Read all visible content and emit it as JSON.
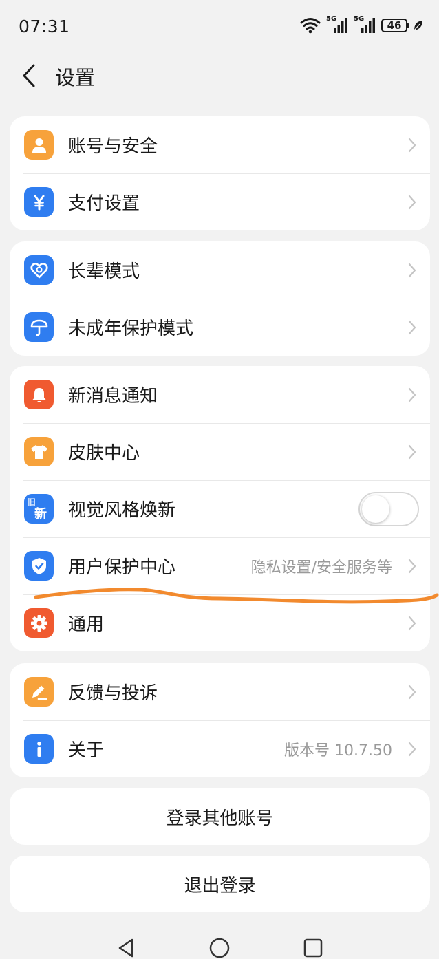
{
  "status": {
    "time": "07:31",
    "net1": "5G",
    "net2": "5G",
    "battery": "46"
  },
  "header": {
    "title": "设置"
  },
  "groups": [
    {
      "items": [
        {
          "label": "账号与安全",
          "icon": "user-icon",
          "color": "#f7a23b"
        },
        {
          "label": "支付设置",
          "icon": "yuan-icon",
          "color": "#2f7df0"
        }
      ]
    },
    {
      "items": [
        {
          "label": "长辈模式",
          "icon": "heart-icon",
          "color": "#2f7df0"
        },
        {
          "label": "未成年保护模式",
          "icon": "umbrella-icon",
          "color": "#2f7df0"
        }
      ]
    },
    {
      "items": [
        {
          "label": "新消息通知",
          "icon": "bell-icon",
          "color": "#f05a30"
        },
        {
          "label": "皮肤中心",
          "icon": "shirt-icon",
          "color": "#f7a23b"
        },
        {
          "label": "视觉风格焕新",
          "icon": "new-style-icon",
          "color": "#2f7df0",
          "icon_text_old": "旧",
          "icon_text_new": "新",
          "toggle": false
        },
        {
          "label": "用户保护中心",
          "icon": "shield-icon",
          "color": "#2f7df0",
          "value": "隐私设置/安全服务等"
        },
        {
          "label": "通用",
          "icon": "gear-icon",
          "color": "#f05a30"
        }
      ]
    },
    {
      "items": [
        {
          "label": "反馈与投诉",
          "icon": "edit-icon",
          "color": "#f7a23b"
        },
        {
          "label": "关于",
          "icon": "info-icon",
          "color": "#2f7df0",
          "value": "版本号 10.7.50"
        }
      ]
    }
  ],
  "buttons": {
    "switch_account": "登录其他账号",
    "logout": "退出登录"
  },
  "colors": {
    "annotation": "#f28a2e",
    "background": "#f2f2f2"
  }
}
